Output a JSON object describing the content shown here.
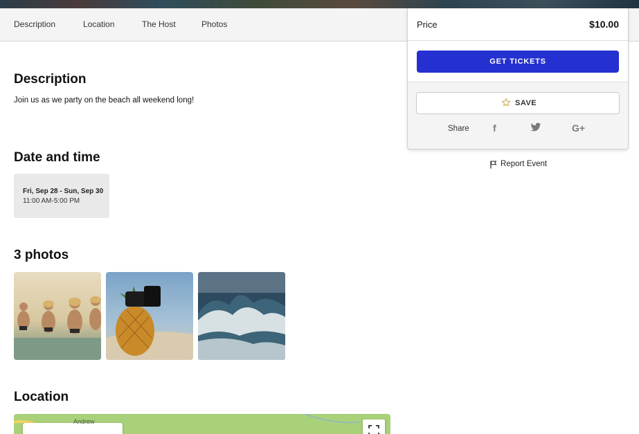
{
  "subnav": {
    "items": [
      {
        "label": "Description"
      },
      {
        "label": "Location"
      },
      {
        "label": "The Host"
      },
      {
        "label": "Photos"
      }
    ]
  },
  "description": {
    "heading": "Description",
    "text": "Join us as we party on the beach all weekend long!"
  },
  "datetime": {
    "heading": "Date and time",
    "date_range": "Fri, Sep 28 - Sun, Sep 30",
    "time_range": "11:00 AM-5:00 PM"
  },
  "photos": {
    "heading": "3 photos",
    "items": [
      {
        "icon": "beach-friends-photo"
      },
      {
        "icon": "pineapple-sunglasses-photo"
      },
      {
        "icon": "ocean-wave-photo"
      }
    ]
  },
  "location": {
    "heading": "Location",
    "map_label": "Andrew"
  },
  "ticket_panel": {
    "price_label": "Price",
    "price_value": "$10.00",
    "get_tickets_label": "GET TICKETS",
    "save_label": "SAVE",
    "share_label": "Share",
    "social": [
      {
        "icon": "facebook-icon",
        "glyph": "f"
      },
      {
        "icon": "twitter-icon",
        "glyph": ""
      },
      {
        "icon": "google-plus-icon",
        "glyph": "G+"
      }
    ]
  },
  "report": {
    "label": "Report Event"
  },
  "colors": {
    "accent": "#2430cf",
    "subnav_bg": "#f4f4f4",
    "date_card_bg": "#e9e9e9",
    "map_green": "#a9d17a",
    "star": "#c9a23a"
  }
}
